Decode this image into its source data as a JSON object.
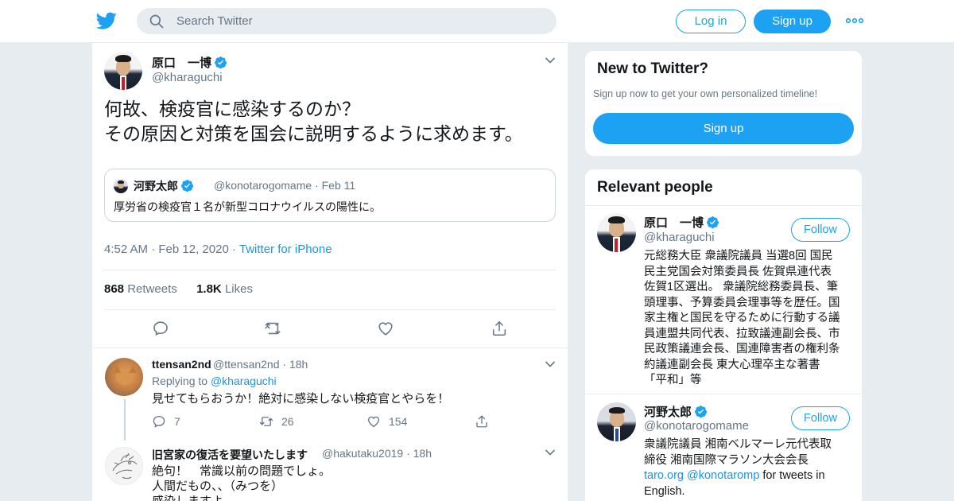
{
  "colors": {
    "accent": "#1da1f2",
    "link": "#1b95e0",
    "muted": "#657786",
    "background": "#e6ecf0"
  },
  "header": {
    "search_placeholder": "Search Twitter",
    "login_label": "Log in",
    "signup_label": "Sign up"
  },
  "tweet": {
    "author_name": "原口　一博",
    "author_handle": "@kharaguchi",
    "text_line1": "何故、検疫官に感染するのか？",
    "text_line2": "その原因と対策を国会に説明するように求めます。",
    "quote": {
      "author_name": "河野太郎",
      "author_handle": "@konotarogomame",
      "date": "Feb 11",
      "text": "厚労省の検疫官１名が新型コロナウイルスの陽性に。"
    },
    "time": "4:52 AM",
    "date": "Feb 12, 2020",
    "source": "Twitter for iPhone",
    "retweets_count": "868",
    "retweets_label": "Retweets",
    "likes_count": "1.8K",
    "likes_label": "Likes"
  },
  "replies": [
    {
      "name": "ttensan2nd",
      "handle": "@ttensan2nd",
      "time": "18h",
      "replying_label": "Replying to",
      "replying_handle": "@kharaguchi",
      "text": "見せてもらおうか！絶対に感染しない検疫官とやらを！",
      "replies": "7",
      "retweets": "26",
      "likes": "154"
    },
    {
      "name": "旧宮家の復活を要望いたします",
      "handle": "@hakutaku2019",
      "time": "18h",
      "text_line1": "絶句！　常識以前の問題でしょ。",
      "text_line2": "人間だもの、、（みつを）",
      "text_line3": "感染しますよ。"
    }
  ],
  "sidebar": {
    "new_title": "New to Twitter?",
    "new_subtitle": "Sign up now to get your own personalized timeline!",
    "signup_label": "Sign up",
    "relevant_title": "Relevant people",
    "people": [
      {
        "name": "原口　一博",
        "handle": "@kharaguchi",
        "follow_label": "Follow",
        "bio_lines": [
          "元総務大臣 衆議院議員 当選8回 国民",
          "民主党国会対策委員長 佐賀県連代表",
          "佐賀1区選出。 衆議院総務委員長、筆",
          "頭理事、予算委員会理事等を歴任。国",
          "家主権と国民を守るために行動する議",
          "員連盟共同代表、拉致議連副会長、市",
          "民政策議連会長、国連障害者の権利条",
          "約議連副会長 東大心理卒主な著書",
          "「平和」等"
        ]
      },
      {
        "name": "河野太郎",
        "handle": "@konotarogomame",
        "follow_label": "Follow",
        "bio_line1": "衆議院議員 湘南ベルマーレ元代表取",
        "bio_line2": "締役 湘南国際マラソン大会会長",
        "bio_link1": "taro.org",
        "bio_link2": "@konotaromp",
        "bio_tail": "for tweets in",
        "bio_line4": "English."
      }
    ]
  }
}
